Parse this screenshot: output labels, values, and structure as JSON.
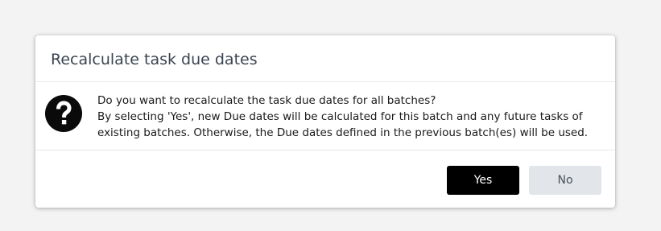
{
  "dialog": {
    "title": "Recalculate task due dates",
    "icon": "question-circle-icon",
    "message_lines": [
      "Do you want to recalculate the task due dates for all batches?",
      "By selecting 'Yes', new Due dates will be calculated for this batch and any future tasks of",
      "existing batches. Otherwise, the Due dates defined in the previous batch(es) will be used."
    ],
    "buttons": {
      "yes_label": "Yes",
      "no_label": "No"
    }
  },
  "colors": {
    "primary_button": "#000000",
    "secondary_button": "#e2e5e9",
    "title_text": "#3b4450"
  }
}
